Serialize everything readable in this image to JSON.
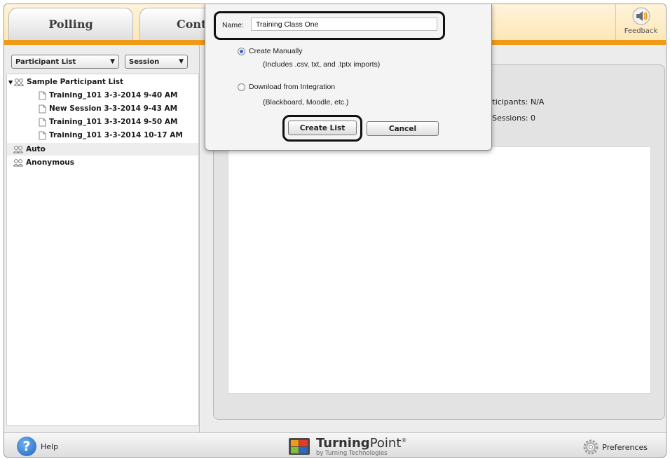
{
  "tabs": [
    {
      "label": "Polling"
    },
    {
      "label": "Cont"
    }
  ],
  "feedback": {
    "label": "Feedback",
    "icon": "speaker-icon"
  },
  "left_panel": {
    "list_selector": "Participant List",
    "session_selector": "Session",
    "tree": {
      "root": "Sample Participant List",
      "sessions": [
        "Training_101 3-3-2014 9-40 AM",
        "New Session 3-3-2014 9-43 AM",
        "Training_101 3-3-2014 9-50 AM",
        "Training_101 3-3-2014 10-17 AM"
      ],
      "auto": "Auto",
      "anonymous": "Anonymous"
    }
  },
  "details": {
    "participants_label": "Participants:",
    "participants_value": "N/A",
    "sessions_label": "of Sessions:",
    "sessions_value": "0"
  },
  "dialog": {
    "name_label": "Name:",
    "name_value": "Training Class One",
    "option_manual": "Create Manually",
    "option_manual_note": "(Includes .csv, txt, and .tptx imports)",
    "option_integration": "Download from Integration",
    "option_integration_note": "(Blackboard, Moodle, etc.)",
    "selected_option": "Create Manually",
    "create_button": "Create List",
    "cancel_button": "Cancel"
  },
  "bottom": {
    "help": "Help",
    "brand_bold": "Turning",
    "brand_light": "Point",
    "brand_reg": "®",
    "brand_sub": "by Turning Technologies",
    "preferences": "Preferences"
  },
  "colors": {
    "accent_orange": "#f09a16",
    "help_blue": "#1d64bd"
  }
}
